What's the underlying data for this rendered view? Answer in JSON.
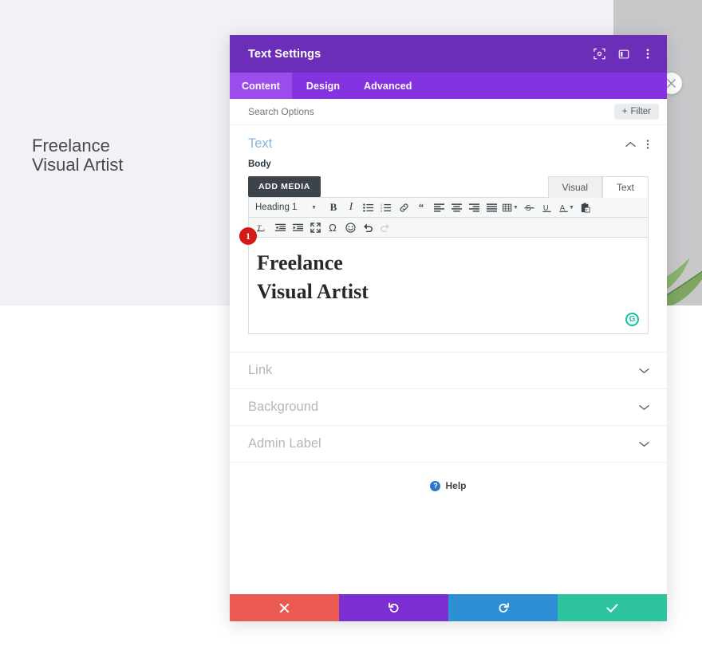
{
  "page": {
    "hero_heading": "Freelance\nVisual Artist",
    "close_icon": "close-icon"
  },
  "modal": {
    "title": "Text Settings",
    "header_icons": [
      {
        "name": "focus-target-icon"
      },
      {
        "name": "panel-layout-icon"
      },
      {
        "name": "more-vertical-icon"
      }
    ],
    "tabs": [
      {
        "label": "Content",
        "active": true
      },
      {
        "label": "Design",
        "active": false
      },
      {
        "label": "Advanced",
        "active": false
      }
    ],
    "search": {
      "placeholder": "Search Options",
      "value": ""
    },
    "filter_label": "Filter",
    "text_section": {
      "title": "Text",
      "field_label": "Body",
      "add_media_label": "ADD MEDIA",
      "editor_tabs": [
        {
          "label": "Visual",
          "active": true
        },
        {
          "label": "Text",
          "active": false
        }
      ],
      "format_select": "Heading 1",
      "toolbar_row1": [
        "bold-icon",
        "italic-icon",
        "bulleted-list-icon",
        "numbered-list-icon",
        "link-icon",
        "blockquote-icon",
        "align-left-icon",
        "align-center-icon",
        "align-right-icon",
        "align-justify-icon",
        "table-icon",
        "strikethrough-icon",
        "underline-icon",
        "text-color-icon",
        "paste-as-text-icon"
      ],
      "toolbar_row2": [
        "clear-formatting-icon",
        "outdent-icon",
        "indent-icon",
        "fullscreen-icon",
        "special-character-icon",
        "emoji-icon",
        "undo-icon",
        "redo-icon"
      ],
      "editor_content": "Freelance\nVisual Artist",
      "annotation_badge": "1",
      "grammarly_icon": "G"
    },
    "sections": [
      {
        "label": "Link"
      },
      {
        "label": "Background"
      },
      {
        "label": "Admin Label"
      }
    ],
    "help_label": "Help",
    "footer_buttons": [
      {
        "name": "cancel-button",
        "icon": "close-icon"
      },
      {
        "name": "undo-button",
        "icon": "undo-icon"
      },
      {
        "name": "redo-button",
        "icon": "redo-icon"
      },
      {
        "name": "save-button",
        "icon": "check-icon"
      }
    ]
  },
  "colors": {
    "header_purple": "#6c2eb9",
    "tabbar_purple": "#8533e0",
    "tab_active_purple": "#9b4ceb",
    "cancel_red": "#eb5a51",
    "undo_purple": "#7b2fd1",
    "redo_blue": "#2e8fd4",
    "save_green": "#2ec4a0",
    "badge_red": "#d41919",
    "section_title_blue": "#8ab4d8"
  }
}
